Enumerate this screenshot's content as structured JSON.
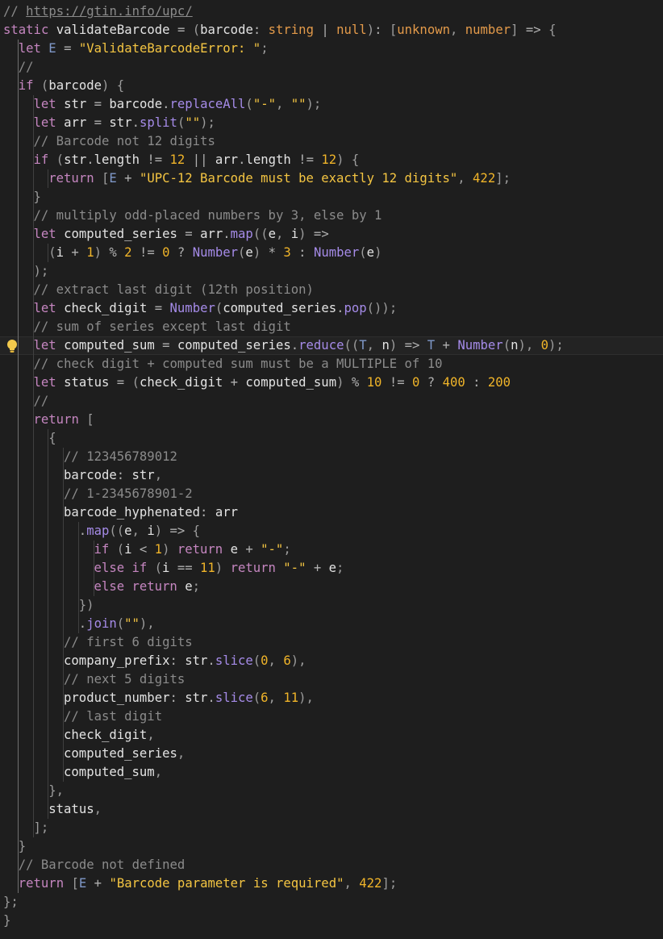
{
  "editor": {
    "language": "javascript",
    "lightbulb_line": 18,
    "colors": {
      "background": "#1e1e1e",
      "keyword": "#c586c0",
      "function": "#a58be8",
      "number": "#f0b429",
      "string": "#f4c542",
      "type": "#e39a4a",
      "comment": "#8b8b8b"
    },
    "lines": [
      {
        "indent": 1,
        "tokens": [
          [
            "cm",
            "// "
          ],
          [
            "link",
            "https://gtin.info/upc/"
          ]
        ]
      },
      {
        "indent": 1,
        "tokens": [
          [
            "kw",
            "static"
          ],
          [
            "id",
            " validateBarcode "
          ],
          [
            "op",
            "="
          ],
          [
            "pu",
            " ("
          ],
          [
            "id",
            "barcode"
          ],
          [
            "op",
            ": "
          ],
          [
            "typ",
            "string"
          ],
          [
            "op",
            " | "
          ],
          [
            "typ",
            "null"
          ],
          [
            "pu",
            ")"
          ],
          [
            "op",
            ": "
          ],
          [
            "pu",
            "["
          ],
          [
            "typ",
            "unknown"
          ],
          [
            "pu",
            ", "
          ],
          [
            "typ",
            "number"
          ],
          [
            "pu",
            "]"
          ],
          [
            "op",
            " => "
          ],
          [
            "pu",
            "{"
          ]
        ]
      },
      {
        "indent": 2,
        "tokens": [
          [
            "kw",
            "let"
          ],
          [
            "pr",
            " E"
          ],
          [
            "op",
            " = "
          ],
          [
            "str",
            "\"ValidateBarcodeError: \""
          ],
          [
            "pu",
            ";"
          ]
        ]
      },
      {
        "indent": 2,
        "tokens": [
          [
            "cm",
            "//"
          ]
        ]
      },
      {
        "indent": 2,
        "tokens": [
          [
            "kw",
            "if"
          ],
          [
            "pu",
            " ("
          ],
          [
            "id",
            "barcode"
          ],
          [
            "pu",
            ") {"
          ]
        ]
      },
      {
        "indent": 3,
        "tokens": [
          [
            "kw",
            "let"
          ],
          [
            "id",
            " str"
          ],
          [
            "op",
            " = "
          ],
          [
            "id",
            "barcode"
          ],
          [
            "op",
            "."
          ],
          [
            "fn",
            "replaceAll"
          ],
          [
            "pu",
            "("
          ],
          [
            "str",
            "\"-\""
          ],
          [
            "pu",
            ", "
          ],
          [
            "str",
            "\"\""
          ],
          [
            "pu",
            ");"
          ]
        ]
      },
      {
        "indent": 3,
        "tokens": [
          [
            "kw",
            "let"
          ],
          [
            "id",
            " arr"
          ],
          [
            "op",
            " = "
          ],
          [
            "id",
            "str"
          ],
          [
            "op",
            "."
          ],
          [
            "fn",
            "split"
          ],
          [
            "pu",
            "("
          ],
          [
            "str",
            "\"\""
          ],
          [
            "pu",
            ");"
          ]
        ]
      },
      {
        "indent": 3,
        "tokens": [
          [
            "cm",
            "// Barcode not 12 digits"
          ]
        ]
      },
      {
        "indent": 3,
        "tokens": [
          [
            "kw",
            "if"
          ],
          [
            "pu",
            " ("
          ],
          [
            "id",
            "str"
          ],
          [
            "op",
            "."
          ],
          [
            "id",
            "length"
          ],
          [
            "op",
            " != "
          ],
          [
            "num",
            "12"
          ],
          [
            "op",
            " || "
          ],
          [
            "id",
            "arr"
          ],
          [
            "op",
            "."
          ],
          [
            "id",
            "length"
          ],
          [
            "op",
            " != "
          ],
          [
            "num",
            "12"
          ],
          [
            "pu",
            ") {"
          ]
        ]
      },
      {
        "indent": 4,
        "tokens": [
          [
            "kw",
            "return"
          ],
          [
            "pu",
            " ["
          ],
          [
            "pr",
            "E"
          ],
          [
            "op",
            " + "
          ],
          [
            "str",
            "\"UPC-12 Barcode must be exactly 12 digits\""
          ],
          [
            "pu",
            ", "
          ],
          [
            "num",
            "422"
          ],
          [
            "pu",
            "];"
          ]
        ]
      },
      {
        "indent": 3,
        "tokens": [
          [
            "pu",
            "}"
          ]
        ]
      },
      {
        "indent": 3,
        "tokens": [
          [
            "cm",
            "// multiply odd-placed numbers by 3, else by 1"
          ]
        ]
      },
      {
        "indent": 3,
        "tokens": [
          [
            "kw",
            "let"
          ],
          [
            "id",
            " computed_series"
          ],
          [
            "op",
            " = "
          ],
          [
            "id",
            "arr"
          ],
          [
            "op",
            "."
          ],
          [
            "fn",
            "map"
          ],
          [
            "pu",
            "(("
          ],
          [
            "id",
            "e"
          ],
          [
            "pu",
            ", "
          ],
          [
            "id",
            "i"
          ],
          [
            "pu",
            ")"
          ],
          [
            "op",
            " =>"
          ]
        ]
      },
      {
        "indent": 4,
        "tokens": [
          [
            "pu",
            "("
          ],
          [
            "id",
            "i"
          ],
          [
            "op",
            " + "
          ],
          [
            "num",
            "1"
          ],
          [
            "pu",
            ")"
          ],
          [
            "op",
            " % "
          ],
          [
            "num",
            "2"
          ],
          [
            "op",
            " != "
          ],
          [
            "num",
            "0"
          ],
          [
            "op",
            " ? "
          ],
          [
            "fn",
            "Number"
          ],
          [
            "pu",
            "("
          ],
          [
            "id",
            "e"
          ],
          [
            "pu",
            ")"
          ],
          [
            "op",
            " * "
          ],
          [
            "num",
            "3"
          ],
          [
            "op",
            " : "
          ],
          [
            "fn",
            "Number"
          ],
          [
            "pu",
            "("
          ],
          [
            "id",
            "e"
          ],
          [
            "pu",
            ")"
          ]
        ]
      },
      {
        "indent": 3,
        "tokens": [
          [
            "pu",
            ");"
          ]
        ]
      },
      {
        "indent": 3,
        "tokens": [
          [
            "cm",
            "// extract last digit (12th position)"
          ]
        ]
      },
      {
        "indent": 3,
        "tokens": [
          [
            "kw",
            "let"
          ],
          [
            "id",
            " check_digit"
          ],
          [
            "op",
            " = "
          ],
          [
            "fn",
            "Number"
          ],
          [
            "pu",
            "("
          ],
          [
            "id",
            "computed_series"
          ],
          [
            "op",
            "."
          ],
          [
            "fn",
            "pop"
          ],
          [
            "pu",
            "());"
          ]
        ]
      },
      {
        "indent": 3,
        "tokens": [
          [
            "cm",
            "// sum of series except last digit"
          ]
        ]
      },
      {
        "indent": 3,
        "tokens": [
          [
            "kw",
            "let"
          ],
          [
            "id",
            " computed_sum"
          ],
          [
            "op",
            " = "
          ],
          [
            "id",
            "computed_series"
          ],
          [
            "op",
            "."
          ],
          [
            "fn",
            "reduce"
          ],
          [
            "pu",
            "(("
          ],
          [
            "pr",
            "T"
          ],
          [
            "pu",
            ", "
          ],
          [
            "id",
            "n"
          ],
          [
            "pu",
            ")"
          ],
          [
            "op",
            " => "
          ],
          [
            "pr",
            "T"
          ],
          [
            "op",
            " + "
          ],
          [
            "fn",
            "Number"
          ],
          [
            "pu",
            "("
          ],
          [
            "id",
            "n"
          ],
          [
            "pu",
            "), "
          ],
          [
            "num",
            "0"
          ],
          [
            "pu",
            ");"
          ]
        ]
      },
      {
        "indent": 3,
        "tokens": [
          [
            "cm",
            "// check digit + computed sum must be a MULTIPLE of 10"
          ]
        ]
      },
      {
        "indent": 3,
        "tokens": [
          [
            "kw",
            "let"
          ],
          [
            "id",
            " status"
          ],
          [
            "op",
            " = "
          ],
          [
            "pu",
            "("
          ],
          [
            "id",
            "check_digit"
          ],
          [
            "op",
            " + "
          ],
          [
            "id",
            "computed_sum"
          ],
          [
            "pu",
            ")"
          ],
          [
            "op",
            " % "
          ],
          [
            "num",
            "10"
          ],
          [
            "op",
            " != "
          ],
          [
            "num",
            "0"
          ],
          [
            "op",
            " ? "
          ],
          [
            "num",
            "400"
          ],
          [
            "op",
            " : "
          ],
          [
            "num",
            "200"
          ]
        ]
      },
      {
        "indent": 3,
        "tokens": [
          [
            "cm",
            "//"
          ]
        ]
      },
      {
        "indent": 3,
        "tokens": [
          [
            "kw",
            "return"
          ],
          [
            "pu",
            " ["
          ]
        ]
      },
      {
        "indent": 4,
        "tokens": [
          [
            "pu",
            "{"
          ]
        ]
      },
      {
        "indent": 5,
        "tokens": [
          [
            "cm",
            "// 123456789012"
          ]
        ]
      },
      {
        "indent": 5,
        "tokens": [
          [
            "id",
            "barcode"
          ],
          [
            "op",
            ": "
          ],
          [
            "id",
            "str"
          ],
          [
            "pu",
            ","
          ]
        ]
      },
      {
        "indent": 5,
        "tokens": [
          [
            "cm",
            "// 1-2345678901-2"
          ]
        ]
      },
      {
        "indent": 5,
        "tokens": [
          [
            "id",
            "barcode_hyphenated"
          ],
          [
            "op",
            ": "
          ],
          [
            "id",
            "arr"
          ]
        ]
      },
      {
        "indent": 6,
        "tokens": [
          [
            "op",
            "."
          ],
          [
            "fn",
            "map"
          ],
          [
            "pu",
            "(("
          ],
          [
            "id",
            "e"
          ],
          [
            "pu",
            ", "
          ],
          [
            "id",
            "i"
          ],
          [
            "pu",
            ")"
          ],
          [
            "op",
            " => "
          ],
          [
            "pu",
            "{"
          ]
        ]
      },
      {
        "indent": 7,
        "tokens": [
          [
            "kw",
            "if"
          ],
          [
            "pu",
            " ("
          ],
          [
            "id",
            "i"
          ],
          [
            "op",
            " < "
          ],
          [
            "num",
            "1"
          ],
          [
            "pu",
            ") "
          ],
          [
            "kw",
            "return"
          ],
          [
            "id",
            " e"
          ],
          [
            "op",
            " + "
          ],
          [
            "str",
            "\"-\""
          ],
          [
            "pu",
            ";"
          ]
        ]
      },
      {
        "indent": 7,
        "tokens": [
          [
            "kw",
            "else if"
          ],
          [
            "pu",
            " ("
          ],
          [
            "id",
            "i"
          ],
          [
            "op",
            " == "
          ],
          [
            "num",
            "11"
          ],
          [
            "pu",
            ") "
          ],
          [
            "kw",
            "return"
          ],
          [
            "str",
            " \"-\""
          ],
          [
            "op",
            " + "
          ],
          [
            "id",
            "e"
          ],
          [
            "pu",
            ";"
          ]
        ]
      },
      {
        "indent": 7,
        "tokens": [
          [
            "kw",
            "else return"
          ],
          [
            "id",
            " e"
          ],
          [
            "pu",
            ";"
          ]
        ]
      },
      {
        "indent": 6,
        "tokens": [
          [
            "pu",
            "})"
          ]
        ]
      },
      {
        "indent": 6,
        "tokens": [
          [
            "op",
            "."
          ],
          [
            "fn",
            "join"
          ],
          [
            "pu",
            "("
          ],
          [
            "str",
            "\"\""
          ],
          [
            "pu",
            "),"
          ]
        ]
      },
      {
        "indent": 5,
        "tokens": [
          [
            "cm",
            "// first 6 digits"
          ]
        ]
      },
      {
        "indent": 5,
        "tokens": [
          [
            "id",
            "company_prefix"
          ],
          [
            "op",
            ": "
          ],
          [
            "id",
            "str"
          ],
          [
            "op",
            "."
          ],
          [
            "fn",
            "slice"
          ],
          [
            "pu",
            "("
          ],
          [
            "num",
            "0"
          ],
          [
            "pu",
            ", "
          ],
          [
            "num",
            "6"
          ],
          [
            "pu",
            "),"
          ]
        ]
      },
      {
        "indent": 5,
        "tokens": [
          [
            "cm",
            "// next 5 digits"
          ]
        ]
      },
      {
        "indent": 5,
        "tokens": [
          [
            "id",
            "product_number"
          ],
          [
            "op",
            ": "
          ],
          [
            "id",
            "str"
          ],
          [
            "op",
            "."
          ],
          [
            "fn",
            "slice"
          ],
          [
            "pu",
            "("
          ],
          [
            "num",
            "6"
          ],
          [
            "pu",
            ", "
          ],
          [
            "num",
            "11"
          ],
          [
            "pu",
            "),"
          ]
        ]
      },
      {
        "indent": 5,
        "tokens": [
          [
            "cm",
            "// last digit"
          ]
        ]
      },
      {
        "indent": 5,
        "tokens": [
          [
            "id",
            "check_digit"
          ],
          [
            "pu",
            ","
          ]
        ]
      },
      {
        "indent": 5,
        "tokens": [
          [
            "id",
            "computed_series"
          ],
          [
            "pu",
            ","
          ]
        ]
      },
      {
        "indent": 5,
        "tokens": [
          [
            "id",
            "computed_sum"
          ],
          [
            "pu",
            ","
          ]
        ]
      },
      {
        "indent": 4,
        "tokens": [
          [
            "pu",
            "},"
          ]
        ]
      },
      {
        "indent": 4,
        "tokens": [
          [
            "id",
            "status"
          ],
          [
            "pu",
            ","
          ]
        ]
      },
      {
        "indent": 3,
        "tokens": [
          [
            "pu",
            "];"
          ]
        ]
      },
      {
        "indent": 2,
        "tokens": [
          [
            "pu",
            "}"
          ]
        ]
      },
      {
        "indent": 2,
        "tokens": [
          [
            "cm",
            "// Barcode not defined"
          ]
        ]
      },
      {
        "indent": 2,
        "tokens": [
          [
            "kw",
            "return"
          ],
          [
            "pu",
            " ["
          ],
          [
            "pr",
            "E"
          ],
          [
            "op",
            " + "
          ],
          [
            "str",
            "\"Barcode parameter is required\""
          ],
          [
            "pu",
            ", "
          ],
          [
            "num",
            "422"
          ],
          [
            "pu",
            "];"
          ]
        ]
      },
      {
        "indent": 1,
        "tokens": [
          [
            "pu",
            "};"
          ]
        ]
      },
      {
        "indent": 0,
        "tokens": [
          [
            "pu",
            "}"
          ]
        ]
      }
    ]
  }
}
